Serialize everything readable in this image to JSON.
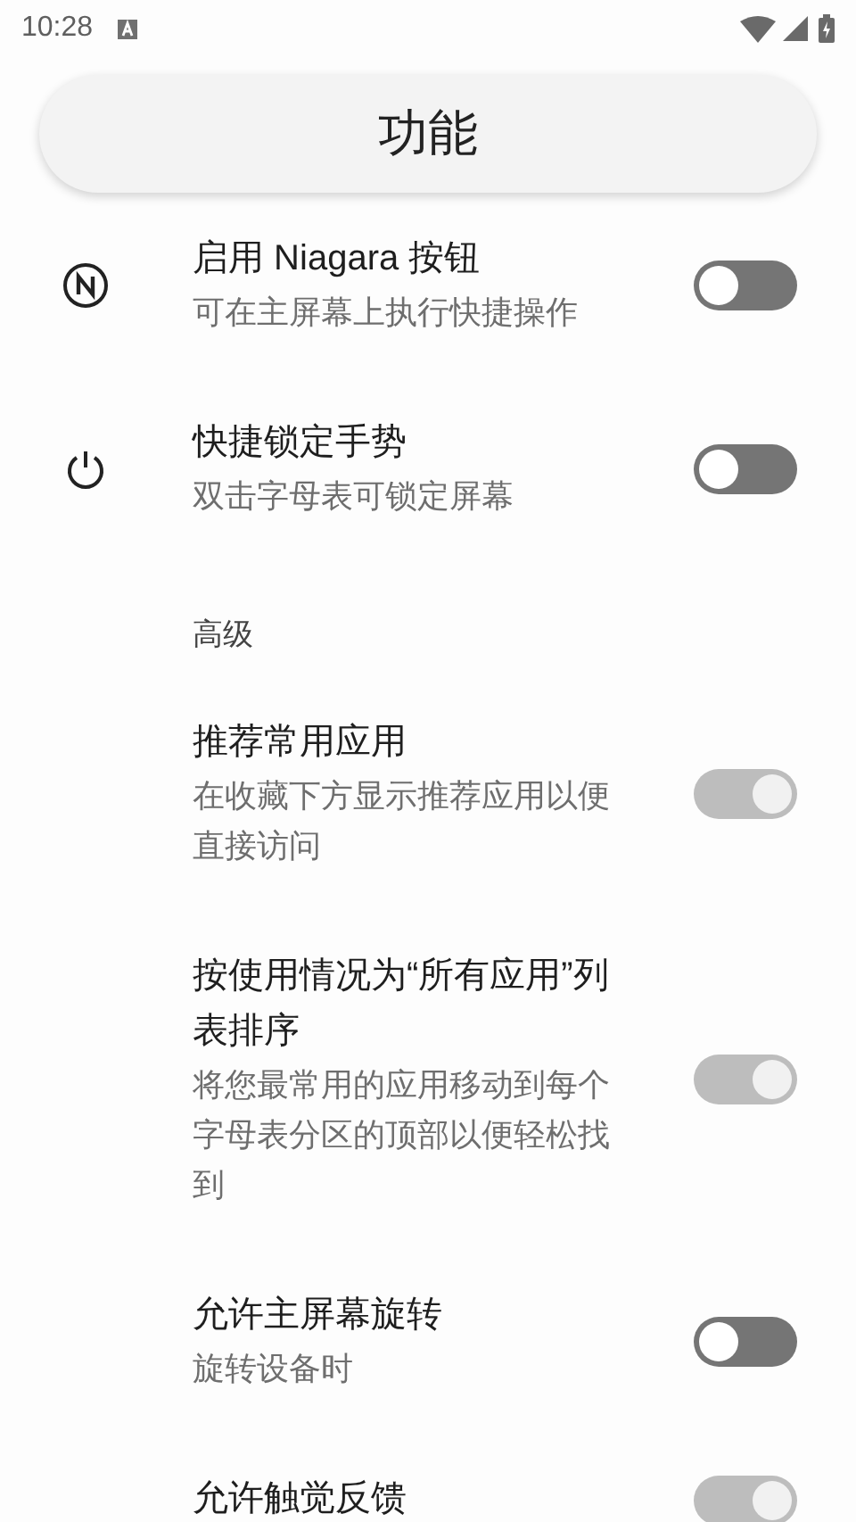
{
  "status_bar": {
    "time": "10:28"
  },
  "header": {
    "title": "功能"
  },
  "items": [
    {
      "kind": "toggle",
      "title": "启用 Niagara 按钮",
      "subtitle": "可在主屏幕上执行快捷操作",
      "on": false,
      "disabled": false
    },
    {
      "kind": "toggle",
      "title": "快捷锁定手势",
      "subtitle": "双击字母表可锁定屏幕",
      "on": false,
      "disabled": false
    },
    {
      "kind": "section",
      "title": "高级"
    },
    {
      "kind": "toggle",
      "title": "推荐常用应用",
      "subtitle": "在收藏下方显示推荐应用以便直接访问",
      "on": true,
      "disabled": true
    },
    {
      "kind": "toggle",
      "title": "按使用情况为“所有应用”列表排序",
      "subtitle": "将您最常用的应用移动到每个字母表分区的顶部以便轻松找到",
      "on": true,
      "disabled": true
    },
    {
      "kind": "toggle",
      "title": "允许主屏幕旋转",
      "subtitle": "旋转设备时",
      "on": false,
      "disabled": false
    },
    {
      "kind": "toggle",
      "title": "允许触觉反馈",
      "on": true,
      "disabled": true
    }
  ]
}
